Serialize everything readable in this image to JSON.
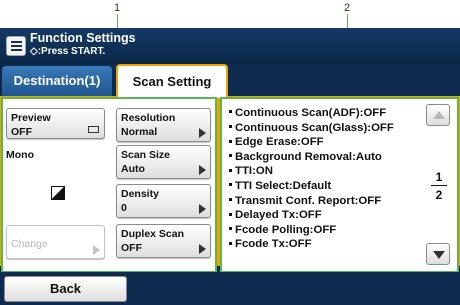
{
  "callouts": {
    "left": "1",
    "right": "2"
  },
  "header": {
    "title": "Function Settings",
    "subtitle": "◇:Press START."
  },
  "tabs": [
    {
      "label": "Destination(1)",
      "selected": false
    },
    {
      "label": "Scan Setting",
      "selected": true
    }
  ],
  "left_panel": {
    "preview": {
      "label": "Preview",
      "value": "OFF"
    },
    "mono_label": "Mono",
    "change_label": "Change",
    "buttons": [
      {
        "label": "Resolution",
        "value": "Normal"
      },
      {
        "label": "Scan Size",
        "value": "Auto"
      },
      {
        "label": "Density",
        "value": "0"
      },
      {
        "label": "Duplex Scan",
        "value": "OFF"
      }
    ]
  },
  "right_panel": {
    "items": [
      "Continuous Scan(ADF):OFF",
      "Continuous Scan(Glass):OFF",
      "Edge Erase:OFF",
      "Background Removal:Auto",
      "TTI:ON",
      "TTI Select:Default",
      "Transmit Conf. Report:OFF",
      "Delayed Tx:OFF",
      "Fcode Polling:OFF",
      "Fcode Tx:OFF"
    ],
    "page_current": "1",
    "page_total": "2"
  },
  "footer": {
    "back_label": "Back"
  },
  "colors": {
    "screen_bg": "#0c2b4e",
    "tab_accent": "#f0a000",
    "callout_green": "#57b84e"
  }
}
